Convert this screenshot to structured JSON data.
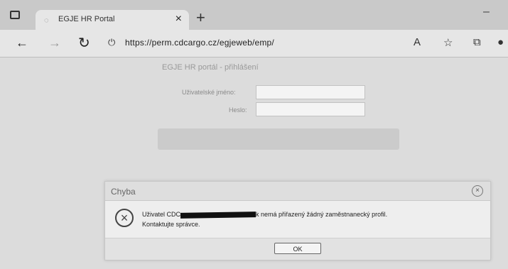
{
  "browser": {
    "tab_title": "EGJE HR Portal",
    "tab_close": "×",
    "new_tab": "+",
    "minimize": "–",
    "url": "https://perm.cdcargo.cz/egjeweb/emp/",
    "icons": [
      "back-icon",
      "forward-icon",
      "reload-icon",
      "lock-icon",
      "read-aloud-icon",
      "favorites-icon",
      "collections-icon",
      "profile-icon"
    ]
  },
  "login": {
    "title": "EGJE HR portál - přihlášení",
    "username_label": "Uživatelské jméno:",
    "password_label": "Heslo:"
  },
  "dialog": {
    "title": "Chyba",
    "close": "×",
    "message_prefix": "Uživatel CDC",
    "message_suffix": "k nemá přiřazený žádný zaměstnanecký profil.",
    "message_line2": "Kontaktujte správce.",
    "ok_label": "OK"
  }
}
